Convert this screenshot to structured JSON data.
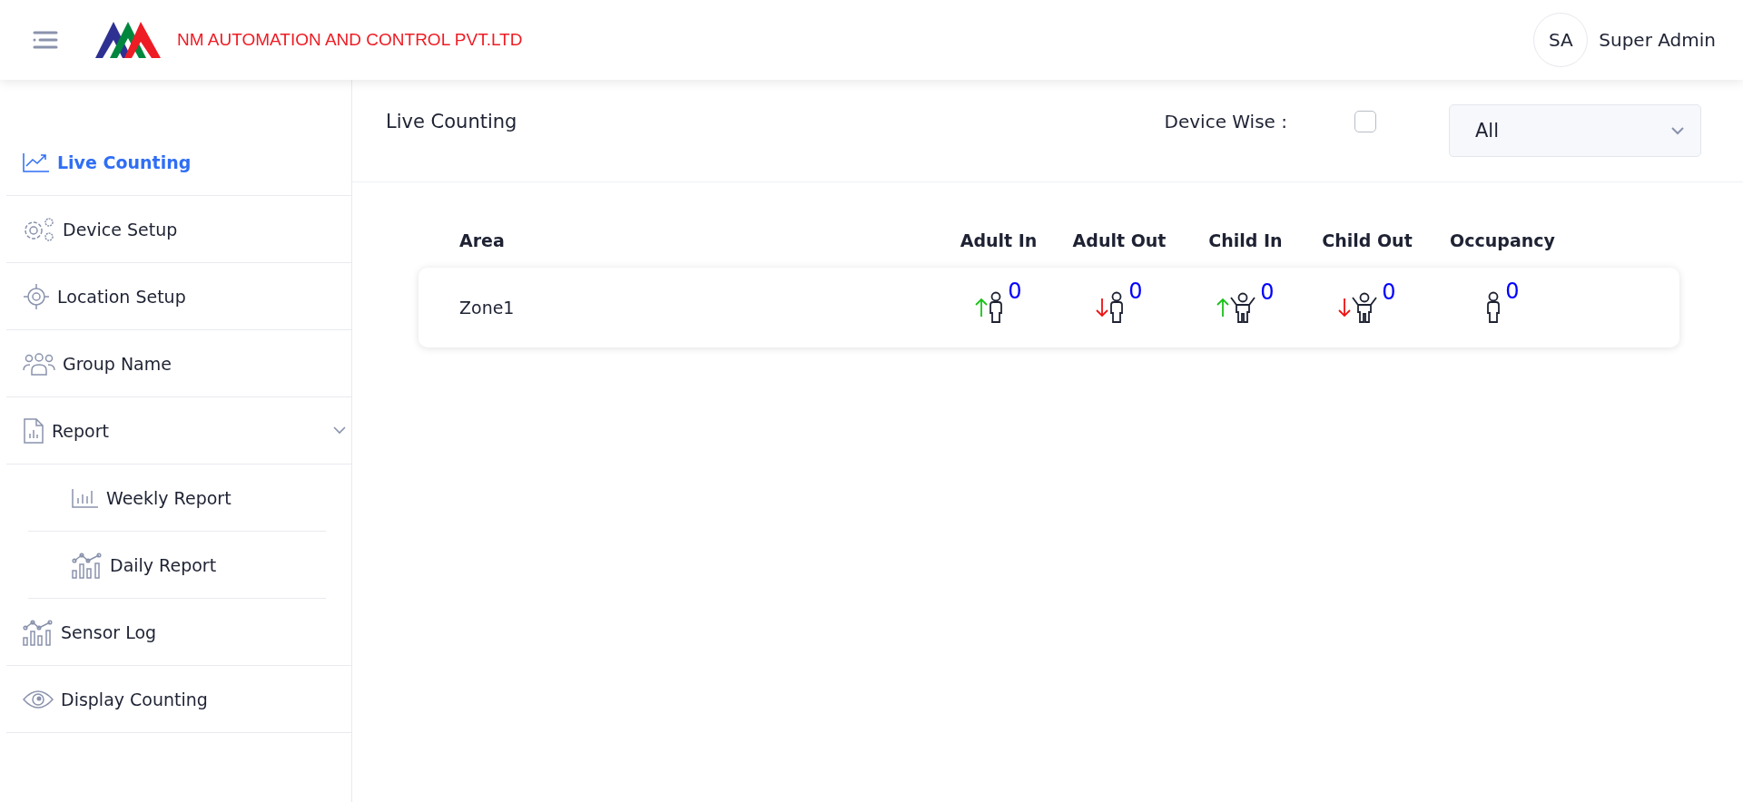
{
  "header": {
    "company": "NM AUTOMATION AND CONTROL PVT.LTD",
    "user": {
      "initials": "SA",
      "name": "Super Admin"
    }
  },
  "sidebar": {
    "items": [
      {
        "label": "Live Counting",
        "selected": true
      },
      {
        "label": "Device Setup",
        "selected": false
      },
      {
        "label": "Location Setup",
        "selected": false
      },
      {
        "label": "Group Name",
        "selected": false
      },
      {
        "label": "Report",
        "selected": false,
        "expanded": true,
        "children": [
          {
            "label": "Weekly Report",
            "selected": false
          },
          {
            "label": "Daily Report",
            "selected": false
          }
        ]
      },
      {
        "label": "Sensor Log",
        "selected": false
      },
      {
        "label": "Display Counting",
        "selected": false
      }
    ]
  },
  "toolbar": {
    "title": "Live Counting",
    "device_wise": {
      "label": "Device Wise :",
      "checked": false
    },
    "select": {
      "value": "All"
    }
  },
  "table": {
    "columns": [
      "Area",
      "Adult In",
      "Adult Out",
      "Child In",
      "Child Out",
      "Occupancy"
    ],
    "rows": [
      {
        "cells": [
          "Zone1",
          "0",
          "0",
          "0",
          "0",
          "0"
        ]
      }
    ]
  }
}
